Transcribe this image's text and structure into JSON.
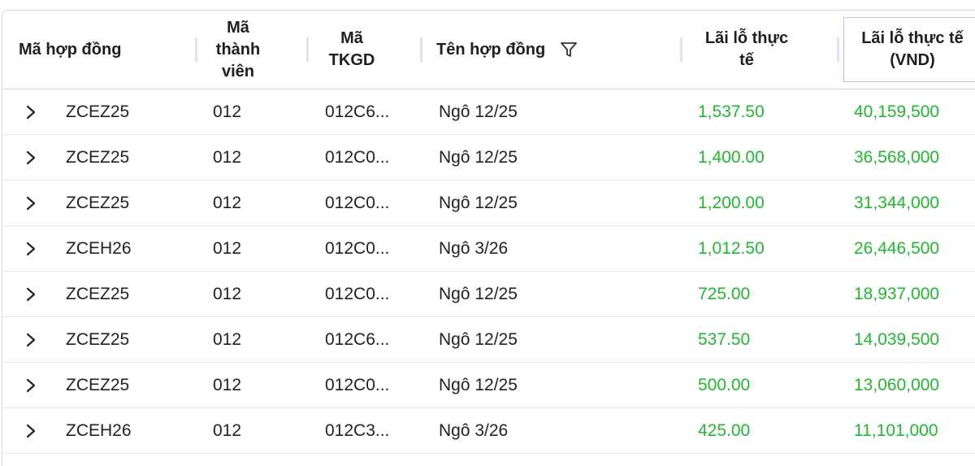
{
  "columns": {
    "contract_code": "Mã hợp đồng",
    "member_code_l1": "Mã",
    "member_code_l2": "thành",
    "member_code_l3": "viên",
    "account_l1": "Mã",
    "account_l2": "TKGD",
    "contract_name": "Tên hợp đồng",
    "pnl_l1": "Lãi lỗ thực",
    "pnl_l2": "tế",
    "pnl_vnd_l1": "Lãi lỗ thực tế",
    "pnl_vnd_l2": "(VND)"
  },
  "icons": {
    "expand": "chevron-right-icon",
    "filter": "filter-icon"
  },
  "colors": {
    "gain": "#21b82f"
  },
  "rows": [
    {
      "code": "ZCEZ25",
      "member": "012",
      "account": "012C6...",
      "name": "Ngô 12/25",
      "pnl": "1,537.50",
      "pnl_vnd": "40,159,500"
    },
    {
      "code": "ZCEZ25",
      "member": "012",
      "account": "012C0...",
      "name": "Ngô 12/25",
      "pnl": "1,400.00",
      "pnl_vnd": "36,568,000"
    },
    {
      "code": "ZCEZ25",
      "member": "012",
      "account": "012C0...",
      "name": "Ngô 12/25",
      "pnl": "1,200.00",
      "pnl_vnd": "31,344,000"
    },
    {
      "code": "ZCEH26",
      "member": "012",
      "account": "012C0...",
      "name": "Ngô 3/26",
      "pnl": "1,012.50",
      "pnl_vnd": "26,446,500"
    },
    {
      "code": "ZCEZ25",
      "member": "012",
      "account": "012C0...",
      "name": "Ngô 12/25",
      "pnl": "725.00",
      "pnl_vnd": "18,937,000"
    },
    {
      "code": "ZCEZ25",
      "member": "012",
      "account": "012C6...",
      "name": "Ngô 12/25",
      "pnl": "537.50",
      "pnl_vnd": "14,039,500"
    },
    {
      "code": "ZCEZ25",
      "member": "012",
      "account": "012C0...",
      "name": "Ngô 12/25",
      "pnl": "500.00",
      "pnl_vnd": "13,060,000"
    },
    {
      "code": "ZCEH26",
      "member": "012",
      "account": "012C3...",
      "name": "Ngô 3/26",
      "pnl": "425.00",
      "pnl_vnd": "11,101,000"
    }
  ]
}
